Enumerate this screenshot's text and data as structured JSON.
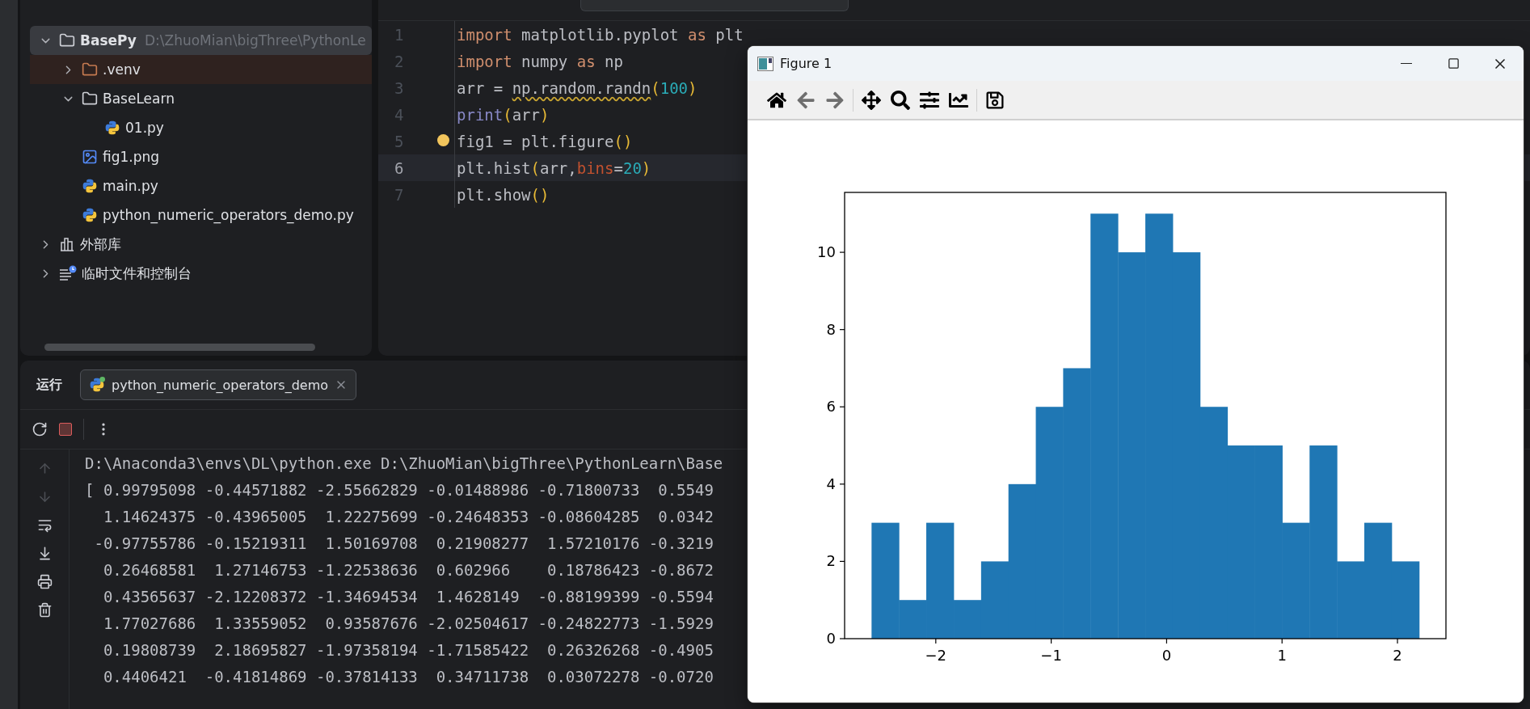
{
  "project_tree": {
    "items": [
      {
        "name": "BasePy",
        "path": "D:\\ZhuoMian\\bigThree\\PythonLe",
        "kind": "folder",
        "expanded": true,
        "selected": true,
        "children": [
          {
            "name": ".venv",
            "kind": "excluded-folder",
            "expanded": false,
            "selected": false
          },
          {
            "name": "BaseLearn",
            "kind": "folder",
            "expanded": true,
            "selected": false,
            "children": [
              {
                "name": "01.py",
                "kind": "python",
                "selected": false
              }
            ]
          },
          {
            "name": "fig1.png",
            "kind": "image",
            "selected": false
          },
          {
            "name": "main.py",
            "kind": "python",
            "selected": false
          },
          {
            "name": "python_numeric_operators_demo.py",
            "kind": "python",
            "selected": false
          }
        ]
      },
      {
        "name": "外部库",
        "kind": "library",
        "expanded": false,
        "selected": false
      },
      {
        "name": "临时文件和控制台",
        "kind": "scratches",
        "expanded": false,
        "selected": false
      }
    ]
  },
  "editor": {
    "lines": [
      {
        "number": "1",
        "current": false,
        "bulb": false,
        "tokens": [
          {
            "text": "import",
            "kind": "keyword"
          },
          {
            "text": " matplotlib.pyplot ",
            "kind": "plain"
          },
          {
            "text": "as",
            "kind": "keyword"
          },
          {
            "text": " plt",
            "kind": "plain"
          }
        ]
      },
      {
        "number": "2",
        "current": false,
        "bulb": false,
        "tokens": [
          {
            "text": "import",
            "kind": "keyword"
          },
          {
            "text": " numpy ",
            "kind": "plain"
          },
          {
            "text": "as",
            "kind": "keyword"
          },
          {
            "text": " np",
            "kind": "plain"
          }
        ]
      },
      {
        "number": "3",
        "current": false,
        "bulb": false,
        "tokens": [
          {
            "text": "arr = ",
            "kind": "plain"
          },
          {
            "text": "np.random.randn",
            "kind": "warning"
          },
          {
            "text": "(",
            "kind": "paren"
          },
          {
            "text": "100",
            "kind": "number"
          },
          {
            "text": ")",
            "kind": "paren"
          }
        ]
      },
      {
        "number": "4",
        "current": false,
        "bulb": false,
        "tokens": [
          {
            "text": "print",
            "kind": "builtin"
          },
          {
            "text": "(",
            "kind": "paren"
          },
          {
            "text": "arr",
            "kind": "plain"
          },
          {
            "text": ")",
            "kind": "paren"
          }
        ]
      },
      {
        "number": "5",
        "current": false,
        "bulb": true,
        "tokens": [
          {
            "text": "fig1 = plt.figure",
            "kind": "plain"
          },
          {
            "text": "()",
            "kind": "paren"
          }
        ]
      },
      {
        "number": "6",
        "current": true,
        "bulb": false,
        "tokens": [
          {
            "text": "plt.hist",
            "kind": "plain"
          },
          {
            "text": "(",
            "kind": "paren"
          },
          {
            "text": "arr,",
            "kind": "plain"
          },
          {
            "text": "bins",
            "kind": "param"
          },
          {
            "text": "=",
            "kind": "plain"
          },
          {
            "text": "20",
            "kind": "number"
          },
          {
            "text": ")",
            "kind": "paren"
          }
        ]
      },
      {
        "number": "7",
        "current": false,
        "bulb": false,
        "tokens": [
          {
            "text": "plt.show",
            "kind": "plain"
          },
          {
            "text": "()",
            "kind": "paren"
          }
        ]
      }
    ]
  },
  "run_panel": {
    "title": "运行",
    "tabs": [
      {
        "label": "python_numeric_operators_demo",
        "selected": true
      }
    ],
    "console_tools": [
      {
        "kind": "up",
        "disabled": true
      },
      {
        "kind": "down",
        "disabled": true
      },
      {
        "kind": "wrap",
        "disabled": false
      },
      {
        "kind": "scroll-end",
        "disabled": false
      },
      {
        "kind": "print",
        "disabled": false
      },
      {
        "kind": "clear",
        "disabled": false
      }
    ],
    "output": [
      "D:\\Anaconda3\\envs\\DL\\python.exe D:\\ZhuoMian\\bigThree\\PythonLearn\\Base",
      "[ 0.99795098 -0.44571882 -2.55662829 -0.01488986 -0.71800733  0.5549",
      "  1.14624375 -0.43965005  1.22275699 -0.24648353 -0.08604285  0.0342",
      " -0.97755786 -0.15219311  1.50169708  0.21908277  1.57210176 -0.3219",
      "  0.26468581  1.27146753 -1.22538636  0.602966    0.18786423 -0.8672",
      "  0.43565637 -2.12208372 -1.34694534  1.4628149  -0.88199399 -0.5594",
      "  1.77027686  1.33559052  0.93587676 -2.02504617 -0.24822773 -1.5929",
      "  0.19808739  2.18695827 -1.97358194 -1.71585422  0.26326268 -0.4905",
      "  0.4406421  -0.41814869 -0.37814133  0.34711738  0.03072278 -0.0720"
    ]
  },
  "figure_window": {
    "title": "Figure 1",
    "toolbar_groups": [
      [
        {
          "kind": "home",
          "disabled": false
        },
        {
          "kind": "back",
          "disabled": true
        },
        {
          "kind": "forward",
          "disabled": true
        }
      ],
      [
        {
          "kind": "pan",
          "disabled": false
        },
        {
          "kind": "zoom",
          "disabled": false
        },
        {
          "kind": "subplots",
          "disabled": false
        },
        {
          "kind": "axes",
          "disabled": false
        }
      ],
      [
        {
          "kind": "save",
          "disabled": false
        }
      ]
    ],
    "chart_data": {
      "type": "bar",
      "x": [
        -2.438,
        -2.201,
        -1.964,
        -1.726,
        -1.489,
        -1.252,
        -1.015,
        -0.778,
        -0.541,
        -0.303,
        -0.066,
        0.171,
        0.408,
        0.645,
        0.883,
        1.12,
        1.357,
        1.594,
        1.831,
        2.069
      ],
      "series": [
        {
          "color": "#1f77b4",
          "values": [
            3,
            1,
            3,
            1,
            2,
            4,
            6,
            7,
            11,
            10,
            11,
            10,
            6,
            5,
            5,
            3,
            5,
            2,
            3,
            2
          ]
        }
      ],
      "xlim": [
        -2.79,
        2.42
      ],
      "ylim": [
        0,
        11.55
      ],
      "xticks": [
        {
          "value": -2,
          "label": "−2"
        },
        {
          "value": -1,
          "label": "−1"
        },
        {
          "value": 0,
          "label": "0"
        },
        {
          "value": 1,
          "label": "1"
        },
        {
          "value": 2,
          "label": "2"
        }
      ],
      "yticks": [
        0,
        2,
        4,
        6,
        8,
        10
      ]
    }
  }
}
